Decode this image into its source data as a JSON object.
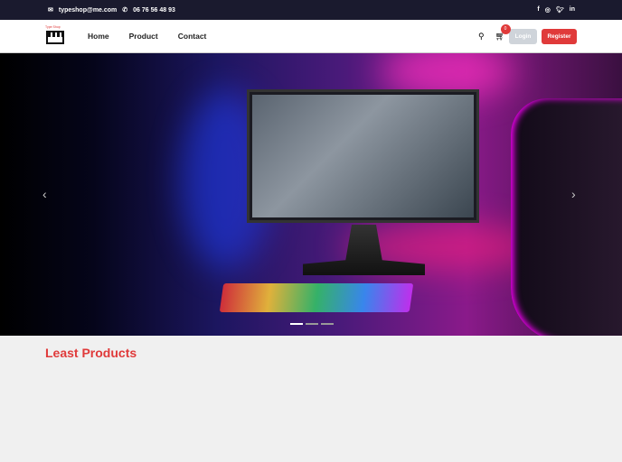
{
  "topbar": {
    "email": "typeshop@me.com",
    "phone": "06 76 56 48 93",
    "social": [
      "facebook-icon",
      "instagram-icon",
      "twitter-icon",
      "linkedin-icon"
    ]
  },
  "nav": {
    "logo_text": "Type Shop",
    "menu": [
      "Home",
      "Product",
      "Contact"
    ],
    "cart_count": "0",
    "login": "Login",
    "register": "Register"
  },
  "hero": {
    "slides": 3,
    "active_slide": 1
  },
  "section": {
    "title": "Least Products"
  }
}
